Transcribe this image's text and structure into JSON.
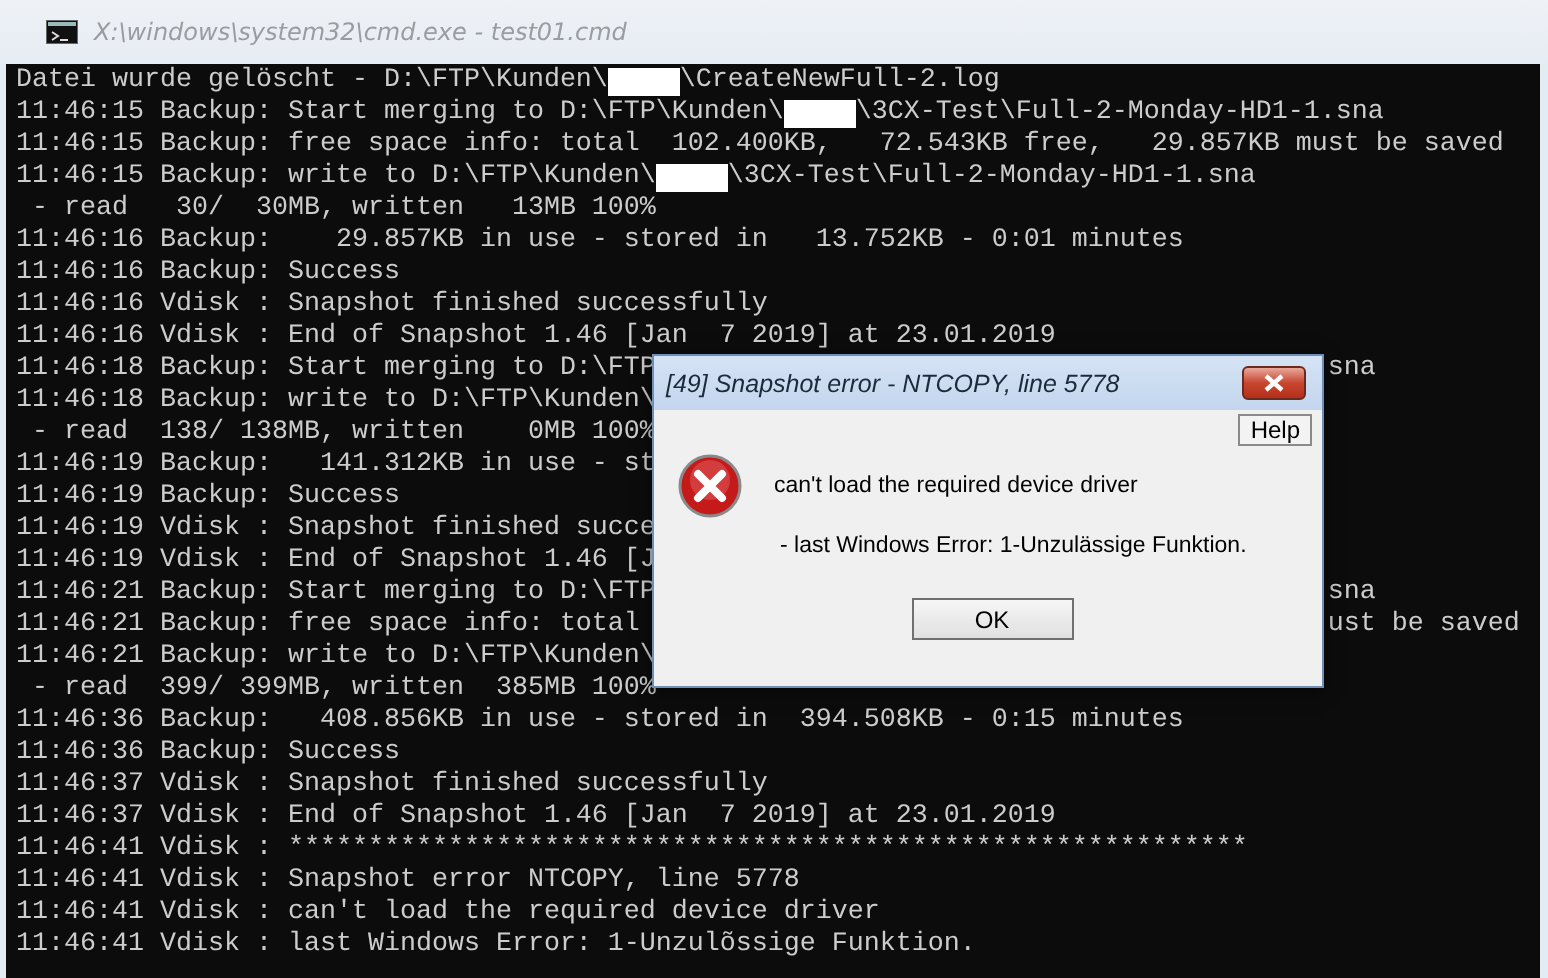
{
  "window": {
    "title": "X:\\windows\\system32\\cmd.exe - test01.cmd"
  },
  "console": {
    "lines": [
      {
        "segments": [
          {
            "kind": "text",
            "text": "Datei wurde gelöscht - D:\\FTP\\Kunden\\"
          },
          {
            "kind": "redacted"
          },
          {
            "kind": "text",
            "text": "\\CreateNewFull-2.log"
          }
        ]
      },
      {
        "segments": [
          {
            "kind": "text",
            "text": "11:46:15 Backup: Start merging to D:\\FTP\\Kunden\\"
          },
          {
            "kind": "redacted"
          },
          {
            "kind": "text",
            "text": "\\3CX-Test\\Full-2-Monday-HD1-1.sna"
          }
        ]
      },
      {
        "segments": [
          {
            "kind": "text",
            "text": "11:46:15 Backup: free space info: total  102.400KB,   72.543KB free,   29.857KB must be saved"
          }
        ]
      },
      {
        "segments": [
          {
            "kind": "text",
            "text": "11:46:15 Backup: write to D:\\FTP\\Kunden\\"
          },
          {
            "kind": "redacted"
          },
          {
            "kind": "text",
            "text": "\\3CX-Test\\Full-2-Monday-HD1-1.sna"
          }
        ]
      },
      {
        "segments": [
          {
            "kind": "text",
            "text": " - read   30/  30MB, written   13MB 100%"
          }
        ]
      },
      {
        "segments": [
          {
            "kind": "text",
            "text": "11:46:16 Backup:    29.857KB in use - stored in   13.752KB - 0:01 minutes"
          }
        ]
      },
      {
        "segments": [
          {
            "kind": "text",
            "text": "11:46:16 Backup: Success"
          }
        ]
      },
      {
        "segments": [
          {
            "kind": "text",
            "text": "11:46:16 Vdisk : Snapshot finished successfully"
          }
        ]
      },
      {
        "segments": [
          {
            "kind": "text",
            "text": "11:46:16 Vdisk : End of Snapshot 1.46 [Jan  7 2019] at 23.01.2019"
          }
        ]
      },
      {
        "segments": [
          {
            "kind": "text",
            "text": "11:46:18 Backup: Start merging to D:\\FTP"
          }
        ],
        "tail": "sna"
      },
      {
        "segments": [
          {
            "kind": "text",
            "text": "11:46:18 Backup: write to D:\\FTP\\Kunden\\"
          }
        ]
      },
      {
        "segments": [
          {
            "kind": "text",
            "text": " - read  138/ 138MB, written    0MB 100%"
          }
        ]
      },
      {
        "segments": [
          {
            "kind": "text",
            "text": "11:46:19 Backup:   141.312KB in use - st"
          }
        ]
      },
      {
        "segments": [
          {
            "kind": "text",
            "text": "11:46:19 Backup: Success"
          }
        ]
      },
      {
        "segments": [
          {
            "kind": "text",
            "text": "11:46:19 Vdisk : Snapshot finished succe"
          }
        ]
      },
      {
        "segments": [
          {
            "kind": "text",
            "text": "11:46:19 Vdisk : End of Snapshot 1.46 [J"
          }
        ]
      },
      {
        "segments": [
          {
            "kind": "text",
            "text": "11:46:21 Backup: Start merging to D:\\FTP"
          }
        ],
        "tail": "sna"
      },
      {
        "segments": [
          {
            "kind": "text",
            "text": "11:46:21 Backup: free space info: total"
          }
        ],
        "tail": "ust be saved"
      },
      {
        "segments": [
          {
            "kind": "text",
            "text": "11:46:21 Backup: write to D:\\FTP\\Kunden\\"
          }
        ]
      },
      {
        "segments": [
          {
            "kind": "text",
            "text": " - read  399/ 399MB, written  385MB 100%"
          }
        ]
      },
      {
        "segments": [
          {
            "kind": "text",
            "text": "11:46:36 Backup:   408.856KB in use - stored in  394.508KB - 0:15 minutes"
          }
        ]
      },
      {
        "segments": [
          {
            "kind": "text",
            "text": "11:46:36 Backup: Success"
          }
        ]
      },
      {
        "segments": [
          {
            "kind": "text",
            "text": "11:46:37 Vdisk : Snapshot finished successfully"
          }
        ]
      },
      {
        "segments": [
          {
            "kind": "text",
            "text": "11:46:37 Vdisk : End of Snapshot 1.46 [Jan  7 2019] at 23.01.2019"
          }
        ]
      },
      {
        "segments": [
          {
            "kind": "text",
            "text": "11:46:41 Vdisk : ************************************************************"
          }
        ]
      },
      {
        "segments": [
          {
            "kind": "text",
            "text": "11:46:41 Vdisk : Snapshot error NTCOPY, line 5778"
          }
        ]
      },
      {
        "segments": [
          {
            "kind": "text",
            "text": "11:46:41 Vdisk : can't load the required device driver"
          }
        ]
      },
      {
        "segments": [
          {
            "kind": "text",
            "text": "11:46:41 Vdisk : last Windows Error: 1-Unzulõssige Funktion."
          }
        ]
      }
    ]
  },
  "dialog": {
    "title": "[49] Snapshot error - NTCOPY, line 5778",
    "help_button": "Help",
    "message": "can't load the required device driver",
    "detail": "- last Windows Error: 1-Unzulässige Funktion.",
    "ok_button": "OK"
  }
}
